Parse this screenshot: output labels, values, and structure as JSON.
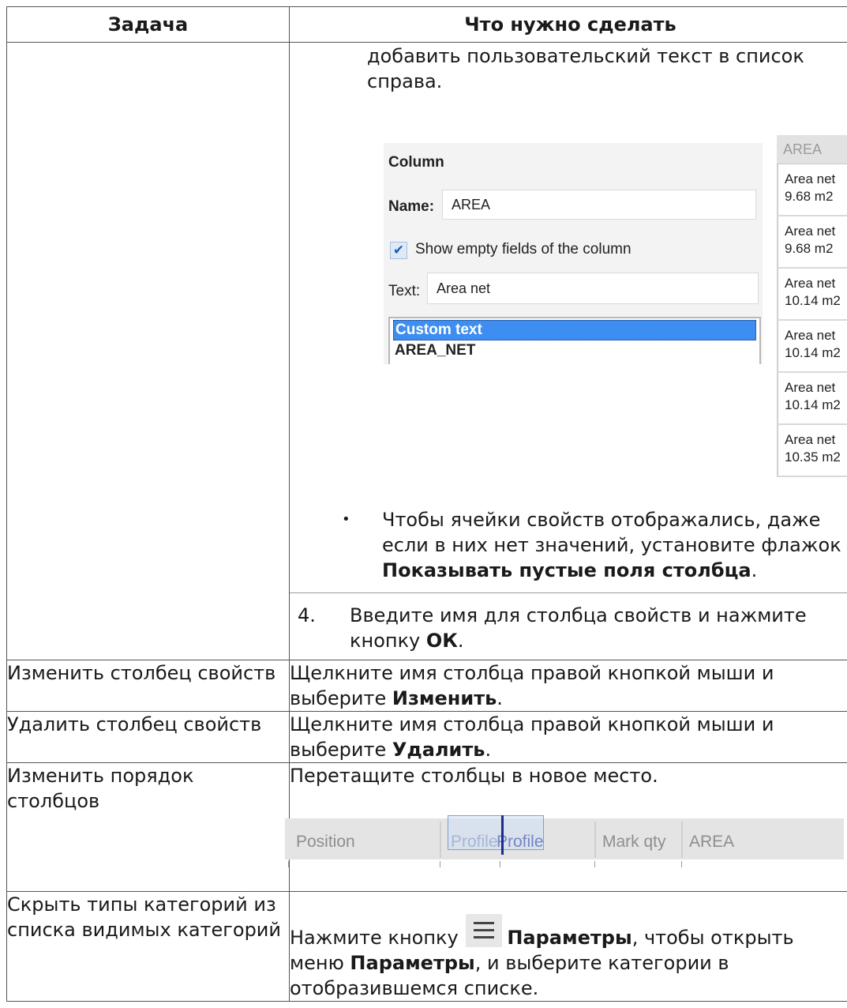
{
  "table": {
    "header": {
      "col1": "Задача",
      "col2": "Что нужно сделать"
    },
    "row1": {
      "cont_text": "добавить пользовательский текст в список справа.",
      "dialog": {
        "column_title": "Column",
        "name_label": "Name:",
        "name_value": "AREA",
        "checkbox_checked": true,
        "checkbox_label": "Show empty fields of the column",
        "text_label": "Text:",
        "text_value": "Area net",
        "list_items": [
          "Custom text",
          "AREA_NET"
        ],
        "selected_item": "Custom text"
      },
      "area_column": {
        "header": "AREA",
        "cells": [
          [
            "Area net",
            "9.68 m2"
          ],
          [
            "Area net",
            "9.68 m2"
          ],
          [
            "Area net",
            "10.14 m2"
          ],
          [
            "Area net",
            "10.14 m2"
          ],
          [
            "Area net",
            "10.14 m2"
          ],
          [
            "Area net",
            "10.35 m2"
          ]
        ]
      },
      "bullet": {
        "marker": "•",
        "text": "Чтобы ячейки свойств отображались, даже если в них нет значений, установите флажок ",
        "bold": "Показывать пустые поля столбца",
        "end": "."
      },
      "step4": {
        "num": "4.",
        "text": "Введите имя для столбца свойств и нажмите кнопку ",
        "bold": "ОК",
        "end": "."
      }
    },
    "row2": {
      "task": "Изменить столбец свойств",
      "text": "Щелкните имя столбца правой кнопкой мыши и выберите ",
      "bold": "Изменить",
      "end": "."
    },
    "row3": {
      "task": "Удалить столбец свойств",
      "text": "Щелкните имя столбца правой кнопкой мыши и выберите ",
      "bold": "Удалить",
      "end": "."
    },
    "row4": {
      "task": "Изменить порядок столбцов",
      "text": "Перетащите столбцы в новое место.",
      "headers": {
        "position": "Position",
        "profile_ghost": "Profile",
        "profile": "Profile",
        "mark_qty": "Mark qty",
        "area": "AREA"
      }
    },
    "row5": {
      "task": "Скрыть типы категорий из списка видимых категорий",
      "text1": "Нажмите кнопку ",
      "icon": "hamburger-menu-icon",
      "bold1": "Параметры",
      "text2": ", чтобы открыть меню ",
      "bold2": "Параметры",
      "text3": ", и выберите категории в отобразившемся списке."
    }
  }
}
